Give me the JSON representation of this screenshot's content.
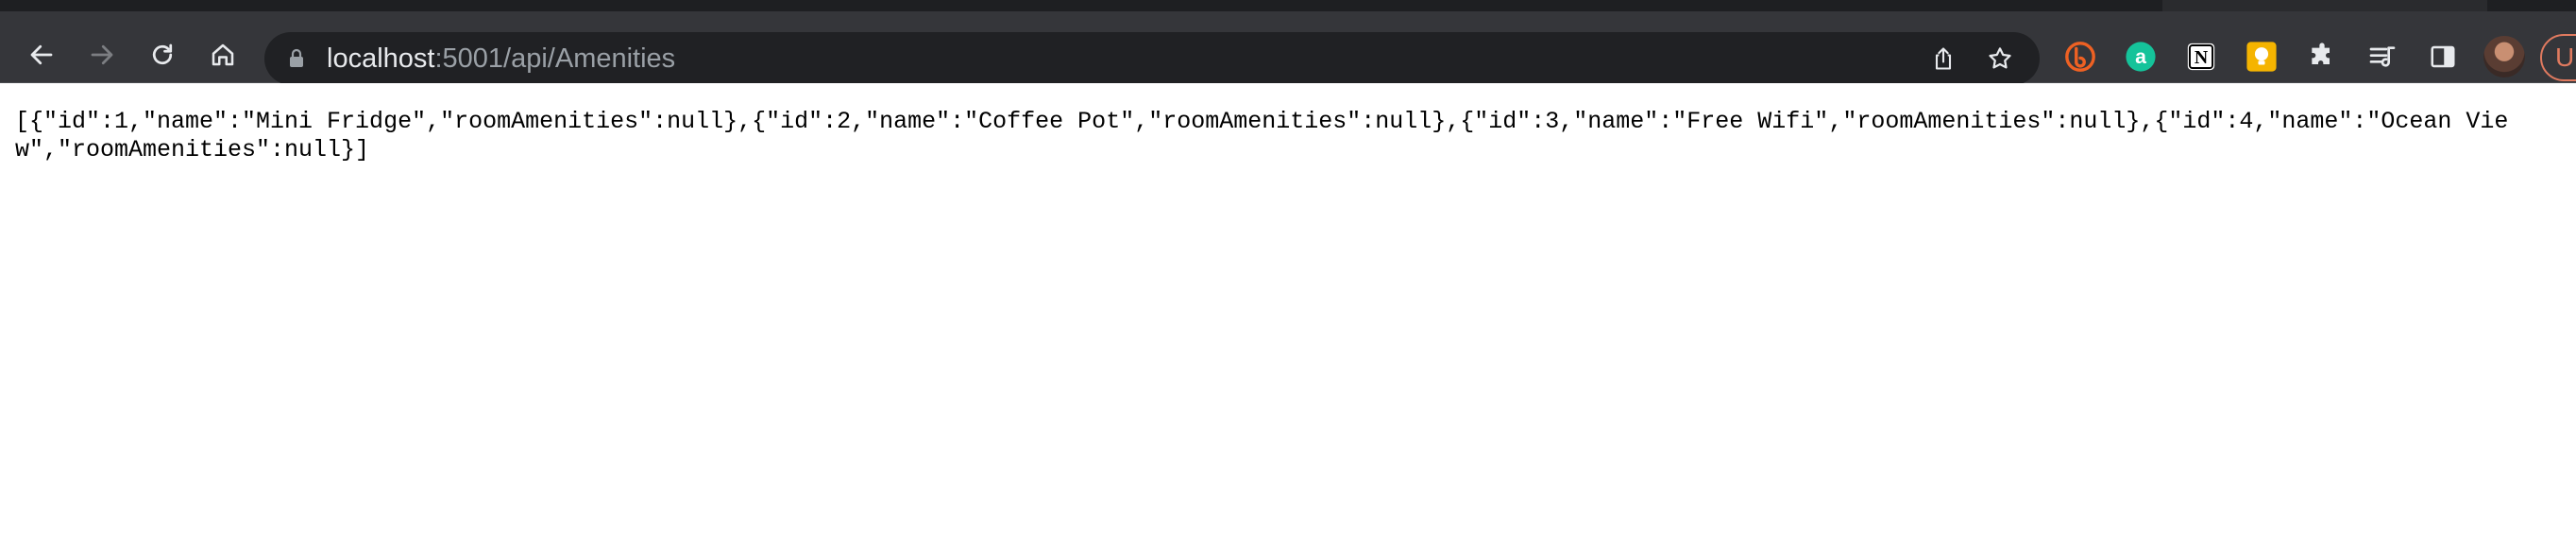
{
  "browser": {
    "url_host": "localhost",
    "url_rest": ":5001/api/Amenities",
    "profile_initial": "U",
    "toolbar_icons": [
      "back-icon",
      "forward-icon",
      "reload-icon",
      "home-icon"
    ],
    "omnibox_icons": [
      "lock-icon",
      "share-icon",
      "bookmark-star-icon"
    ],
    "extensions": [
      "bitly-extension-icon",
      "grammarly-extension-icon",
      "notion-extension-icon",
      "idea-bulb-extension-icon",
      "puzzle-extensions-icon",
      "reading-list-icon",
      "side-panel-icon"
    ]
  },
  "page": {
    "body_text": "[{\"id\":1,\"name\":\"Mini Fridge\",\"roomAmenities\":null},{\"id\":2,\"name\":\"Coffee Pot\",\"roomAmenities\":null},{\"id\":3,\"name\":\"Free Wifi\",\"roomAmenities\":null},{\"id\":4,\"name\":\"Ocean View\",\"roomAmenities\":null}]"
  },
  "colors": {
    "toolbar_bg": "#35363a",
    "omnibox_bg": "#202124",
    "page_bg": "#ffffff",
    "accent": "#e07a5f"
  }
}
